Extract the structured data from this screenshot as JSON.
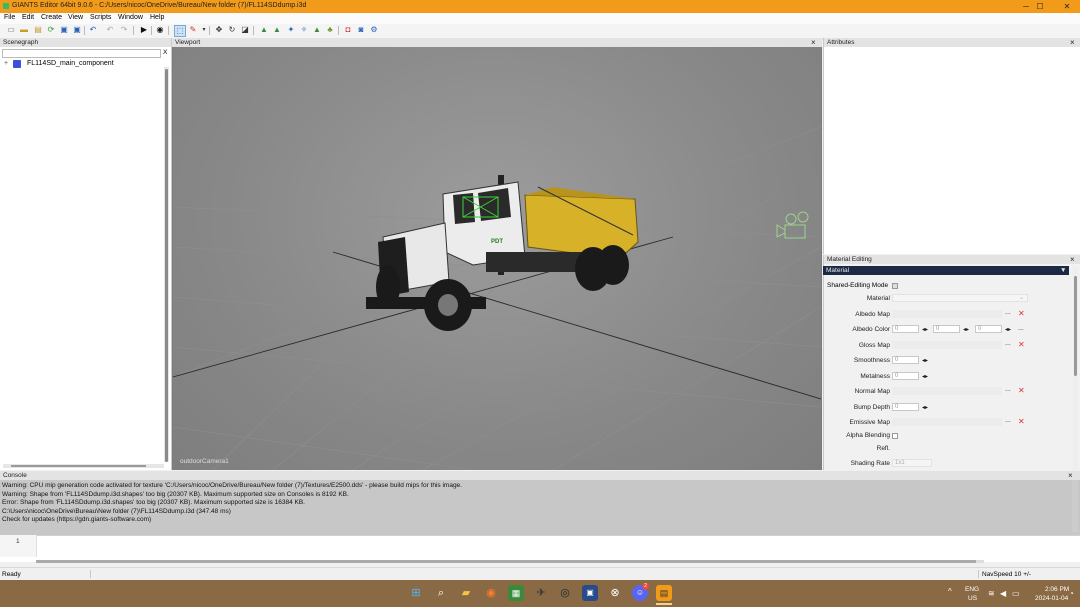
{
  "window": {
    "title": "GIANTS Editor 64bit 9.0.6 - C:/Users/nicoc/OneDrive/Bureau/New folder (7)/FL114SDdump.i3d",
    "minimize": "─",
    "maximize": "☐",
    "close": "✕"
  },
  "menu": [
    "File",
    "Edit",
    "Create",
    "View",
    "Scripts",
    "Window",
    "Help"
  ],
  "panels": {
    "scenegraph": {
      "title": "Scenegraph",
      "close": "×",
      "filter_clear": "X",
      "tree_node": "FL114SD_main_component",
      "expander": "+"
    },
    "viewport": {
      "title": "Viewport",
      "close": "×",
      "camera_label": "outdoorCamera1"
    },
    "attributes": {
      "title": "Attributes",
      "close": "×"
    },
    "material_editing": {
      "title": "Material Editing",
      "close": "×",
      "header": "Material",
      "header_arrow": "▼"
    }
  },
  "material": {
    "shared_editing_mode": "Shared-Editing Mode",
    "material_label": "Material",
    "albedo_map": "Albedo Map",
    "albedo_color": "Albedo Color",
    "albedo_values": [
      "0",
      "0",
      "0"
    ],
    "gloss_map": "Gloss Map",
    "smoothness": "Smoothness",
    "smoothness_value": "0",
    "metalness": "Metalness",
    "metalness_value": "0",
    "normal_map": "Normal Map",
    "bump_depth": "Bump Depth",
    "bump_depth_value": "0",
    "emissive_map": "Emissive Map",
    "alpha_blending": "Alpha Blending",
    "refl": "Refl.",
    "shading_rate": "Shading Rate",
    "shading_rate_value": "1x1",
    "dots": "...",
    "remove": "✕",
    "spin": "◂▸"
  },
  "console": {
    "title": "Console",
    "close": "×",
    "lines": [
      "Warning: CPU mip generation code activated for texture 'C:/Users/nicoc/OneDrive/Bureau/New folder (7)/Textures/E2500.dds' - please build mips for this image.",
      "Warning: Shape from 'FL114SDdump.i3d.shapes' too big (20307 KB). Maximum supported size on Consoles is 8192 KB.",
      "Error: Shape from 'FL114SDdump.i3d.shapes' too big (20307 KB). Maximum supported size is 16384 KB.",
      "C:\\Users\\nicoc\\OneDrive\\Bureau\\New folder (7)\\FL114SDdump.i3d (347.48 ms)",
      "Check for updates (https://gdn.giants-software.com)"
    ]
  },
  "script": {
    "line_number": "1"
  },
  "status": {
    "left": "Ready",
    "navspeed": "NavSpeed 10 +/-"
  },
  "taskbar": {
    "lang_top": "ENG",
    "lang_bottom": "US",
    "time": "2:06 PM",
    "date": "2024-01-04",
    "chevron": "^",
    "badge": "2"
  },
  "colors": {
    "titlebar": "#f29b1a",
    "material_header": "#1c2a46",
    "truck_body": "#d7b128",
    "taskbar": "#8a6a44"
  }
}
